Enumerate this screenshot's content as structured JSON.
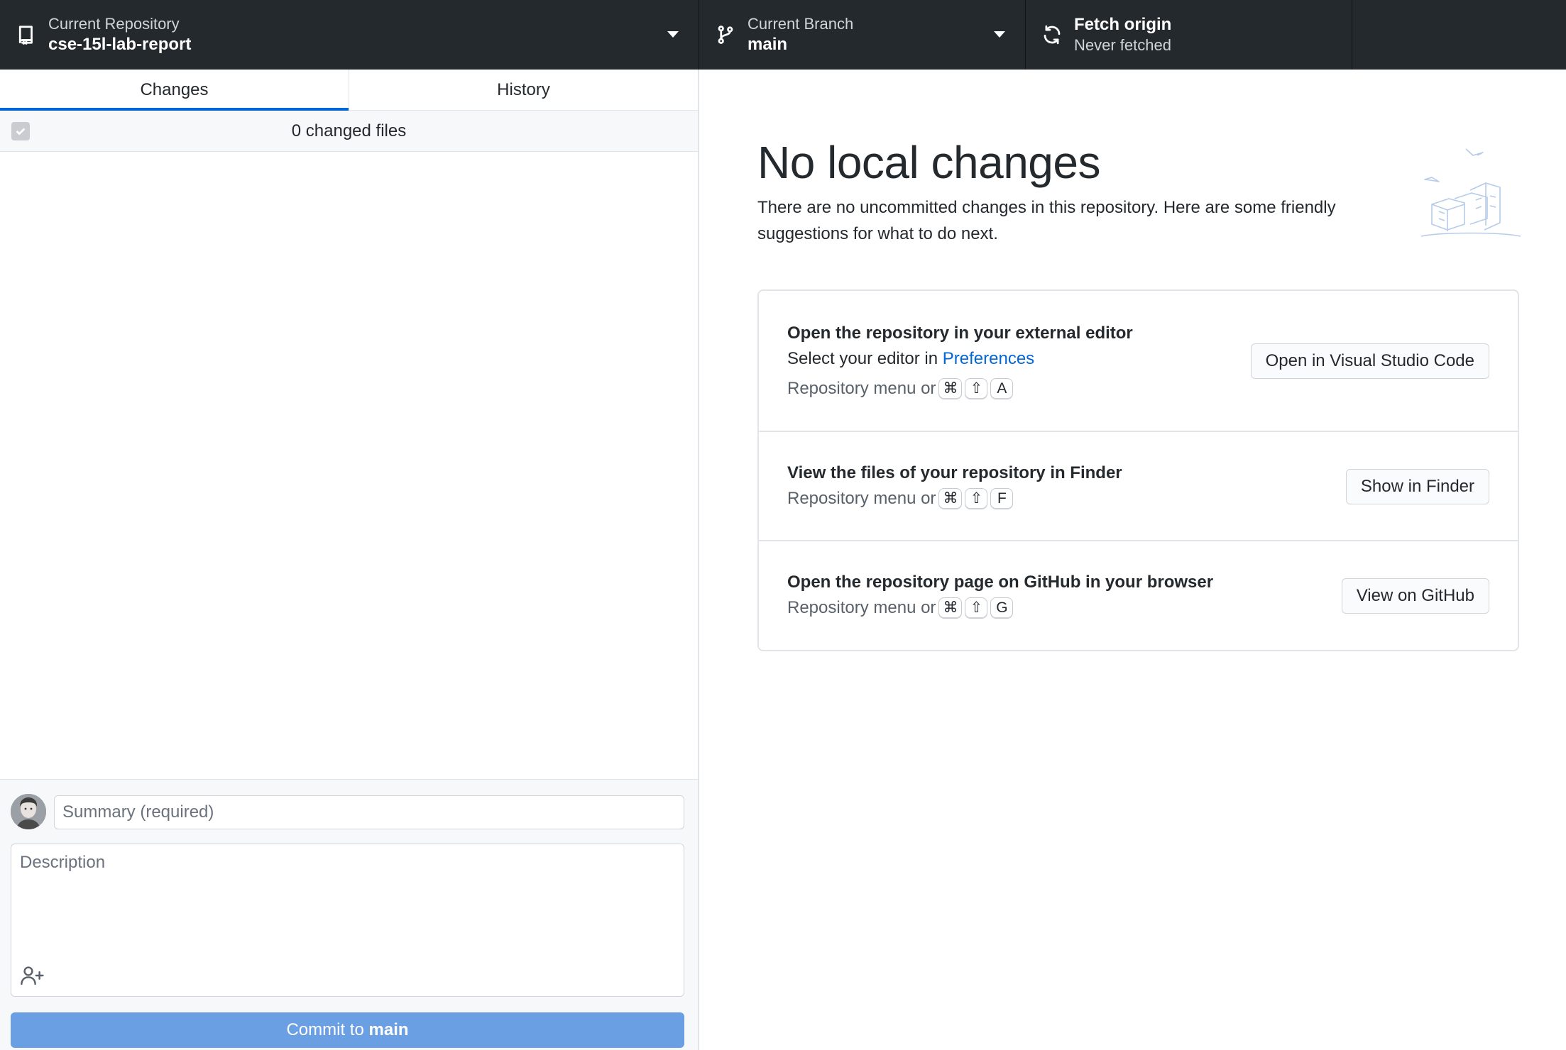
{
  "toolbar": {
    "repository": {
      "label": "Current Repository",
      "name": "cse-15l-lab-report",
      "icon": "repo-icon"
    },
    "branch": {
      "label": "Current Branch",
      "name": "main",
      "icon": "git-branch-icon"
    },
    "fetch": {
      "title": "Fetch origin",
      "subtitle": "Never fetched",
      "icon": "sync-icon"
    }
  },
  "sidebar": {
    "tabs": [
      {
        "label": "Changes",
        "active": true
      },
      {
        "label": "History",
        "active": false
      }
    ],
    "changes_count_label": "0 changed files",
    "commit": {
      "summary_placeholder": "Summary (required)",
      "description_placeholder": "Description",
      "button_prefix": "Commit to",
      "button_branch": "main"
    }
  },
  "main": {
    "title": "No local changes",
    "description": "There are no uncommitted changes in this repository. Here are some friendly suggestions for what to do next.",
    "actions": [
      {
        "title": "Open the repository in your external editor",
        "line_prefix": "Select your editor in",
        "line_link": "Preferences",
        "shortcut_prefix": "Repository menu or",
        "keys": [
          "⌘",
          "⇧",
          "A"
        ],
        "button": "Open in Visual Studio Code"
      },
      {
        "title": "View the files of your repository in Finder",
        "shortcut_prefix": "Repository menu or",
        "keys": [
          "⌘",
          "⇧",
          "F"
        ],
        "button": "Show in Finder"
      },
      {
        "title": "Open the repository page on GitHub in your browser",
        "shortcut_prefix": "Repository menu or",
        "keys": [
          "⌘",
          "⇧",
          "G"
        ],
        "button": "View on GitHub"
      }
    ]
  },
  "colors": {
    "toolbar_bg": "#24292e",
    "accent": "#0366d6",
    "commit_button": "#6a9fe3"
  }
}
